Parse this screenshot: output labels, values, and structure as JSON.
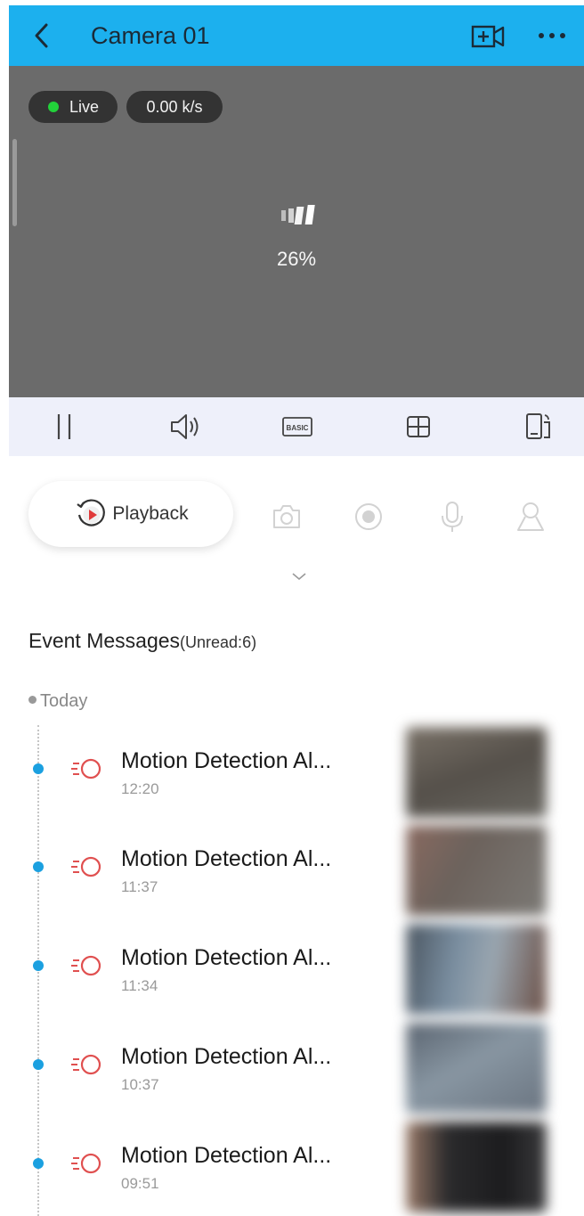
{
  "header": {
    "title": "Camera 01",
    "icons": [
      "back-chevron-icon",
      "add-camera-icon",
      "more-icon"
    ]
  },
  "video": {
    "live_label": "Live",
    "rate": "0.00 k/s",
    "loading_percent": "26%",
    "live_color": "#22d13a"
  },
  "toolbar": {
    "basic_label": "BASIC",
    "icons": [
      "pause-icon",
      "volume-icon",
      "quality-basic-icon",
      "split-view-icon",
      "rotate-screen-icon"
    ]
  },
  "actions": {
    "playback_label": "Playback",
    "icons": [
      "playback-icon",
      "snapshot-icon",
      "record-icon",
      "microphone-icon",
      "ptz-person-icon"
    ]
  },
  "events": {
    "title": "Event Messages",
    "unread": "(Unread:6)",
    "group_label": "Today",
    "items": [
      {
        "title": "Motion Detection Al...",
        "time": "12:20"
      },
      {
        "title": "Motion Detection Al...",
        "time": "11:37"
      },
      {
        "title": "Motion Detection Al...",
        "time": "11:34"
      },
      {
        "title": "Motion Detection Al...",
        "time": "10:37"
      },
      {
        "title": "Motion Detection Al...",
        "time": "09:51"
      }
    ]
  },
  "colors": {
    "header": "#1cb0ee",
    "video_bg": "#6b6b6b",
    "toolbar_bg": "#eef0fa",
    "accent_red": "#e05050",
    "timeline_dot": "#1ba0e0"
  }
}
